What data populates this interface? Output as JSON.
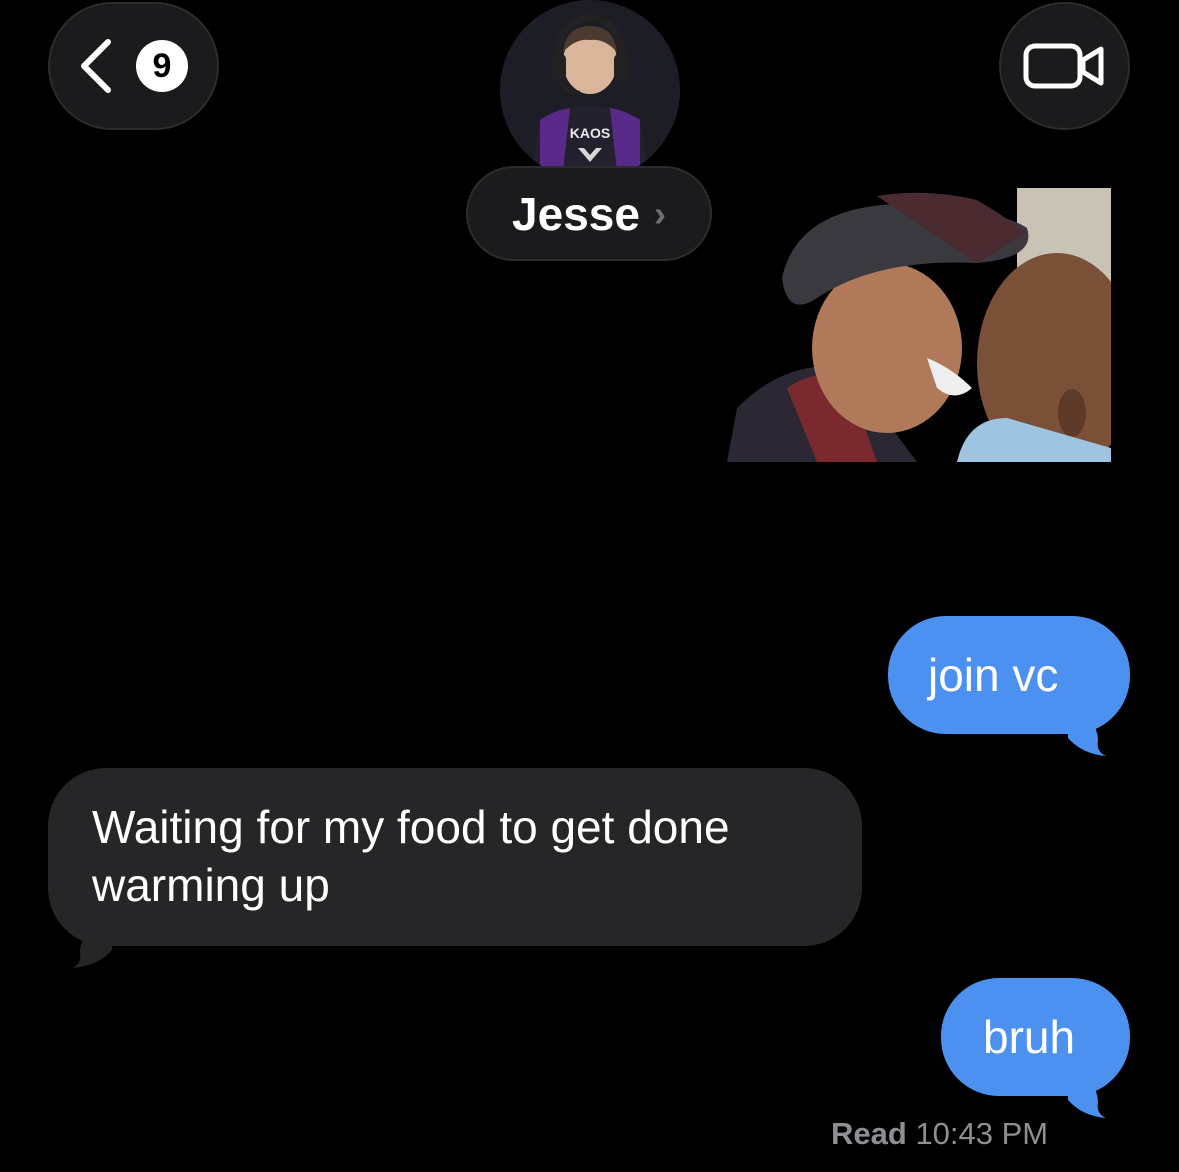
{
  "header": {
    "back_badge_count": "9",
    "contact_name": "Jesse",
    "name_chevron": "›",
    "icons": [
      "chevron-left-icon",
      "video-camera-icon"
    ],
    "avatar_shirt_text": "KAOS"
  },
  "messages": [
    {
      "direction": "incoming",
      "type": "image",
      "description_icon": "photo-attachment"
    },
    {
      "direction": "outgoing",
      "type": "text",
      "text": "join vc"
    },
    {
      "direction": "incoming",
      "type": "text",
      "text": "Waiting for my food to get done warming up"
    },
    {
      "direction": "outgoing",
      "type": "text",
      "text": "bruh"
    }
  ],
  "receipt": {
    "label": "Read",
    "time": "10:43 PM"
  },
  "colors": {
    "background": "#000000",
    "sent_bubble": "#4c91f0",
    "received_bubble": "#262628",
    "header_pill": "#1b1b1d",
    "secondary_text": "#8e8e93"
  }
}
